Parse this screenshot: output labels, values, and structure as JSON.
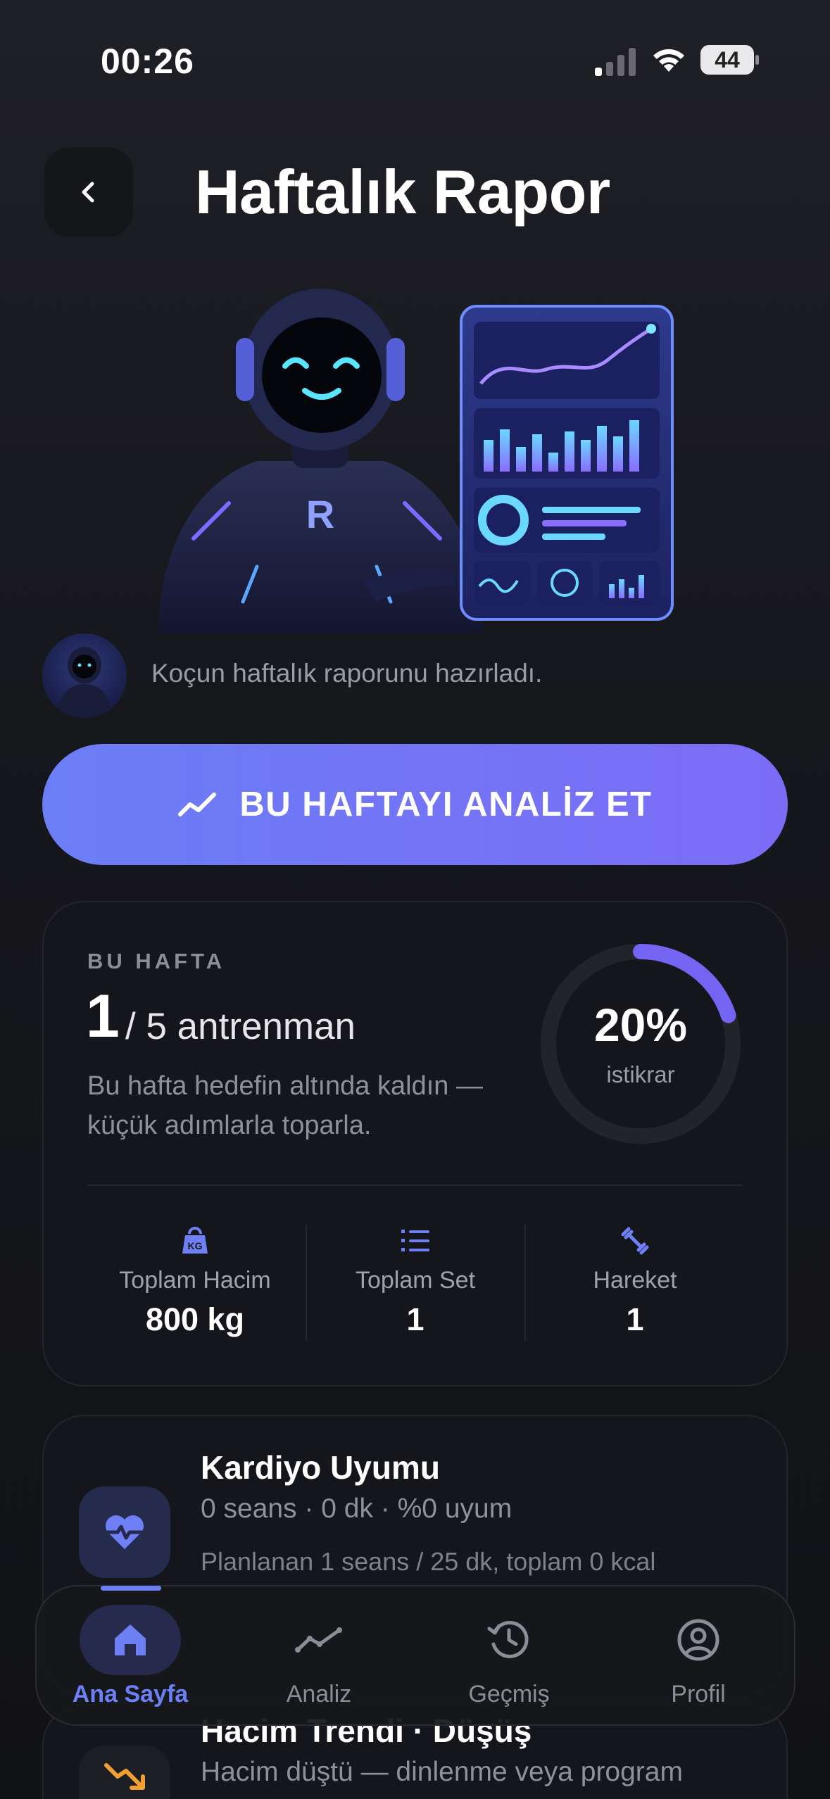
{
  "status_bar": {
    "time": "00:26",
    "battery": "44"
  },
  "header": {
    "title": "Haftalık Rapor"
  },
  "hero": {
    "robot_badge_letter": "R"
  },
  "coach": {
    "message": "Koçun haftalık raporunu hazırladı."
  },
  "cta": {
    "label": "BU HAFTAYI ANALİZ ET",
    "icon": "trend-up-icon"
  },
  "summary": {
    "kicker": "BU HAFTA",
    "count": "1",
    "count_rest": "/ 5 antrenman",
    "note": "Bu hafta hedefin altında kaldın — küçük adımlarla toparla.",
    "consistency_value": "20%",
    "consistency_fraction": 0.2,
    "consistency_label": "istikrar",
    "stats": [
      {
        "label": "Toplam Hacim",
        "value": "800 kg",
        "icon": "kg-weight-icon"
      },
      {
        "label": "Toplam Set",
        "value": "1",
        "icon": "list-icon"
      },
      {
        "label": "Hareket",
        "value": "1",
        "icon": "dumbbell-icon"
      }
    ]
  },
  "cardio": {
    "title": "Kardiyo Uyumu",
    "subtitle": "0 seans · 0 dk · %0 uyum",
    "plan": "Planlanan 1 seans / 25 dk, toplam 0 kcal"
  },
  "trend": {
    "title": "Hacim Trendi · Düşüş",
    "subtitle": "Hacim düştü — dinlenme veya program"
  },
  "tabbar": {
    "tabs": [
      {
        "label": "Ana Sayfa",
        "icon": "home-icon",
        "active": true
      },
      {
        "label": "Analiz",
        "icon": "analytics-icon",
        "active": false
      },
      {
        "label": "Geçmiş",
        "icon": "history-icon",
        "active": false
      },
      {
        "label": "Profil",
        "icon": "profile-icon",
        "active": false
      }
    ]
  },
  "colors": {
    "accent": "#6b7ef5",
    "accent2": "#7b6cf6",
    "background": "#17181d",
    "card": "#15161b",
    "trend_down": "#f0a030"
  }
}
